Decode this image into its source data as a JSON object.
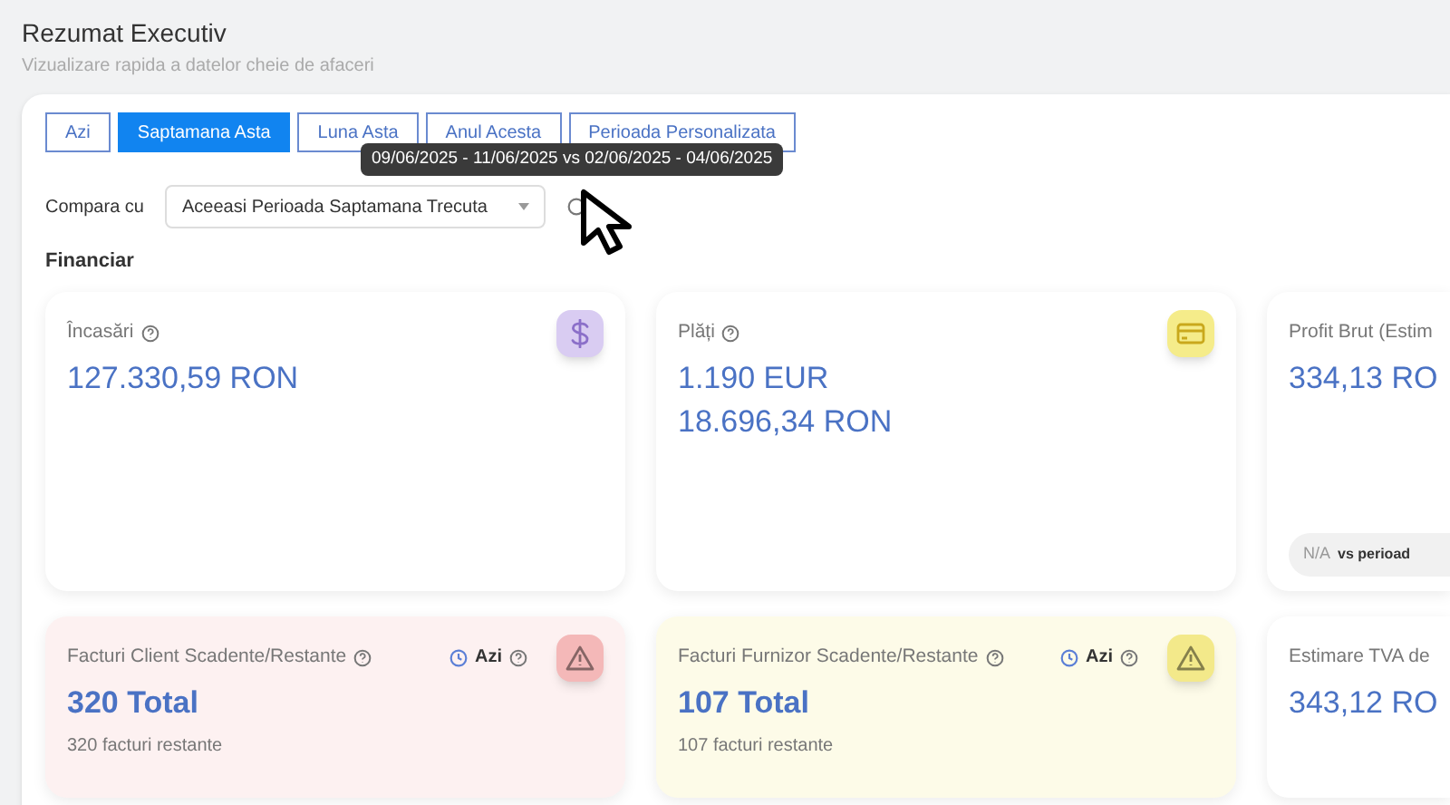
{
  "header": {
    "title": "Rezumat Executiv",
    "subtitle": "Vizualizare rapida a datelor cheie de afaceri"
  },
  "period_tabs": [
    {
      "label": "Azi",
      "selected": false
    },
    {
      "label": "Saptamana Asta",
      "selected": true
    },
    {
      "label": "Luna Asta",
      "selected": false
    },
    {
      "label": "Anul Acesta",
      "selected": false
    },
    {
      "label": "Perioada Personalizata",
      "selected": false
    }
  ],
  "tooltip": "09/06/2025 - 11/06/2025 vs 02/06/2025 - 04/06/2025",
  "compare": {
    "label": "Compara cu",
    "value": "Aceeasi Perioada Saptamana Trecuta"
  },
  "section_title": "Financiar",
  "rows": [
    [
      {
        "kind": "income",
        "title": "Încasări",
        "color": "#d9ccf2",
        "values": [
          "127.330,59 RON"
        ]
      },
      {
        "kind": "payments",
        "title": "Plăți",
        "color": "#f5ec8a",
        "values": [
          "1.190 EUR",
          "18.696,34 RON"
        ]
      },
      {
        "kind": "plain",
        "title": "Profit Brut (Estim",
        "values": [
          "334,13 RO"
        ],
        "footer": {
          "value": "N/A",
          "text": "vs perioad"
        }
      }
    ],
    [
      {
        "kind": "alert",
        "title": "Facturi Client Scadente/Restante",
        "color": "#f4b8b8",
        "period": "Azi",
        "values": [
          "320 Total"
        ],
        "note": "320 facturi restante"
      },
      {
        "kind": "alert",
        "title": "Facturi Furnizor Scadente/Restante",
        "color": "#f3e98a",
        "period": "Azi",
        "values": [
          "107 Total"
        ],
        "note": "107 facturi restante"
      },
      {
        "kind": "plain",
        "title": "Estimare TVA de",
        "values": [
          "343,12 RO"
        ]
      }
    ]
  ]
}
